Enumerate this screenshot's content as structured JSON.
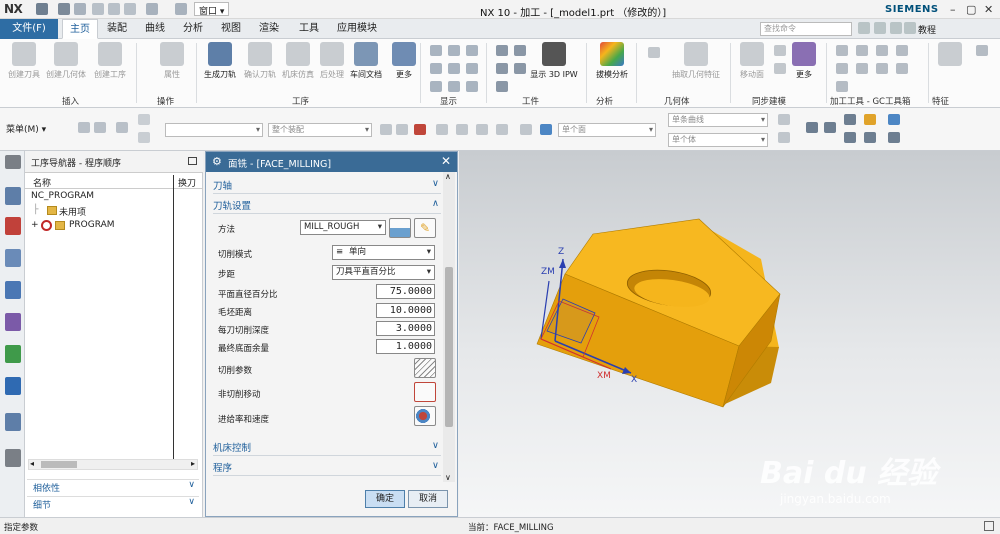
{
  "app": {
    "logo": "NX",
    "title": "NX 10 - 加工 - [_model1.prt （修改的）]",
    "brand": "SIEMENS",
    "window_menu": "窗口 ▾"
  },
  "ribbon_tabs": {
    "file": "文件(F)",
    "tabs": [
      "主页",
      "装配",
      "曲线",
      "分析",
      "视图",
      "渲染",
      "工具",
      "应用模块"
    ],
    "search_placeholder": "查找命令",
    "tutorial": "教程"
  },
  "ribbon": {
    "buttons": [
      {
        "label": "创建刀具",
        "enabled": false
      },
      {
        "label": "创建几何体",
        "enabled": false
      },
      {
        "label": "创建工序",
        "enabled": false
      },
      {
        "label": "属性",
        "enabled": false
      },
      {
        "label": "生成刀轨",
        "enabled": true
      },
      {
        "label": "确认刀轨",
        "enabled": false
      },
      {
        "label": "机床仿真",
        "enabled": false
      },
      {
        "label": "后处理",
        "enabled": false
      },
      {
        "label": "车间文档",
        "enabled": true
      },
      {
        "label": "更多",
        "enabled": true
      },
      {
        "label": "显示 3D IPW",
        "enabled": true
      },
      {
        "label": "拔模分析",
        "enabled": true
      },
      {
        "label": "抽取几何特征",
        "enabled": false
      },
      {
        "label": "移动面",
        "enabled": false
      },
      {
        "label": "更多",
        "enabled": true
      }
    ],
    "groups": [
      "插入",
      "操作",
      "工序",
      "显示",
      "工件",
      "分析",
      "几何体",
      "同步建模",
      "加工工具 - GC工具箱",
      "特征"
    ]
  },
  "toolbar2": {
    "menu": "菜单(M) ▾",
    "combo1": "",
    "combo2": "整个装配",
    "combo3": "单个面",
    "combo4": "单条曲线",
    "combo5": "单个体"
  },
  "navigator": {
    "title": "工序导航器 - 程序顺序",
    "col_name": "名称",
    "col_tool": "换刀",
    "rows": [
      {
        "name": "NC_PROGRAM",
        "indent": 0
      },
      {
        "name": "未用项",
        "indent": 1
      },
      {
        "name": "PROGRAM",
        "indent": 1
      }
    ],
    "acc1": "相依性",
    "acc2": "细节"
  },
  "dialog": {
    "title": "面铣 - [FACE_MILLING]",
    "sec_tool_axis": "刀轴",
    "sec_path": "刀轨设置",
    "method_label": "方法",
    "method_value": "MILL_ROUGH",
    "cut_mode_label": "切削模式",
    "cut_mode_value": "单向",
    "stepover_label": "步距",
    "stepover_value": "刀具平直百分比",
    "flat_pct_label": "平面直径百分比",
    "flat_pct_value": "75.0000",
    "blank_dist_label": "毛坯距离",
    "blank_dist_value": "10.0000",
    "depth_label": "每刀切削深度",
    "depth_value": "3.0000",
    "floor_stock_label": "最终底面余量",
    "floor_stock_value": "1.0000",
    "cut_params_label": "切削参数",
    "non_cut_label": "非切削移动",
    "feeds_label": "进给率和速度",
    "sec_machine": "机床控制",
    "sec_program": "程序",
    "ok": "确定",
    "cancel": "取消"
  },
  "viewport": {
    "axis_z": "Z",
    "axis_zm": "ZM",
    "axis_x": "X",
    "axis_xm": "XM",
    "part_color": "#f5b51c",
    "watermark": "Bai du 经验",
    "watermark_url": "jingyan.baidu.com"
  },
  "status": {
    "left": "指定参数",
    "center": "当前：FACE_MILLING"
  }
}
